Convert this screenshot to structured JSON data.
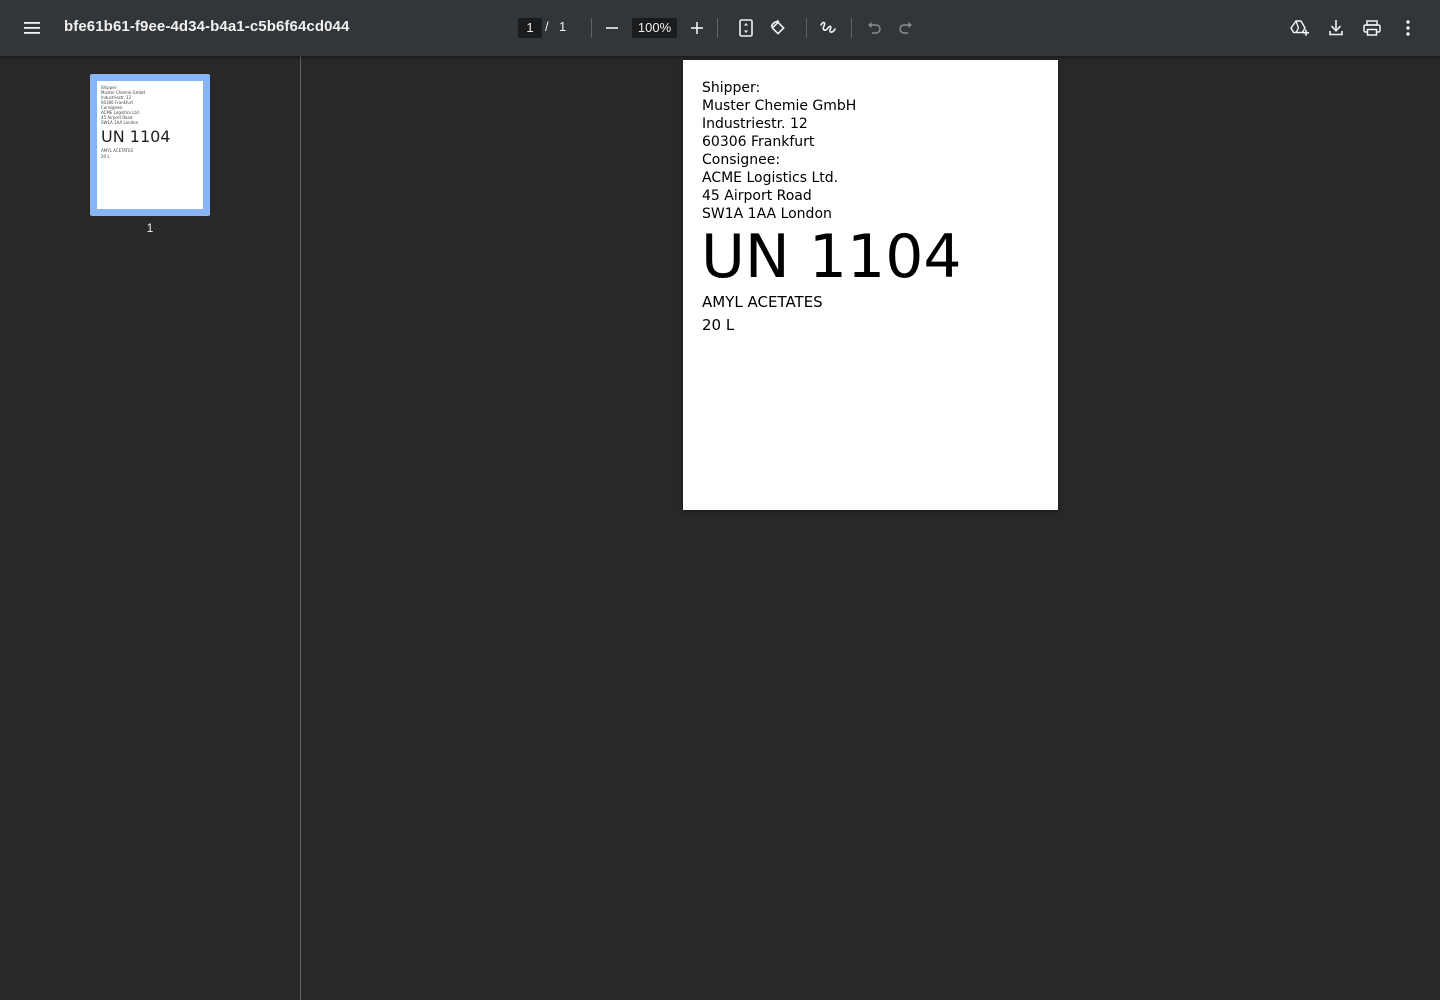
{
  "toolbar": {
    "title": "bfe61b61-f9ee-4d34-b4a1-c5b6f64cd044",
    "page_current": "1",
    "page_separator": "/",
    "page_total": "1",
    "zoom": "100%",
    "icons": {
      "menu": "menu-icon",
      "zoom_out": "minus-icon",
      "zoom_in": "plus-icon",
      "fit": "fit-page-icon",
      "rotate": "rotate-icon",
      "annotate": "draw-icon",
      "undo": "undo-icon",
      "redo": "redo-icon",
      "drive": "add-to-drive-icon",
      "download": "download-icon",
      "print": "print-icon",
      "more": "more-vert-icon"
    }
  },
  "sidebar": {
    "thumbnails": [
      {
        "label": "1"
      }
    ]
  },
  "document": {
    "lines": [
      "Shipper:",
      "Muster Chemie GmbH",
      "Industriestr. 12",
      "60306 Frankfurt",
      "Consignee:",
      "ACME Logistics Ltd.",
      "45 Airport Road",
      "SW1A 1AA London"
    ],
    "un_number": "UN 1104",
    "substance": "AMYL ACETATES",
    "quantity": "20 L"
  },
  "colors": {
    "toolbar_bg": "#323639",
    "viewer_bg": "#282828",
    "thumb_selected": "#8ab4f8",
    "text": "#f1f1f1"
  }
}
